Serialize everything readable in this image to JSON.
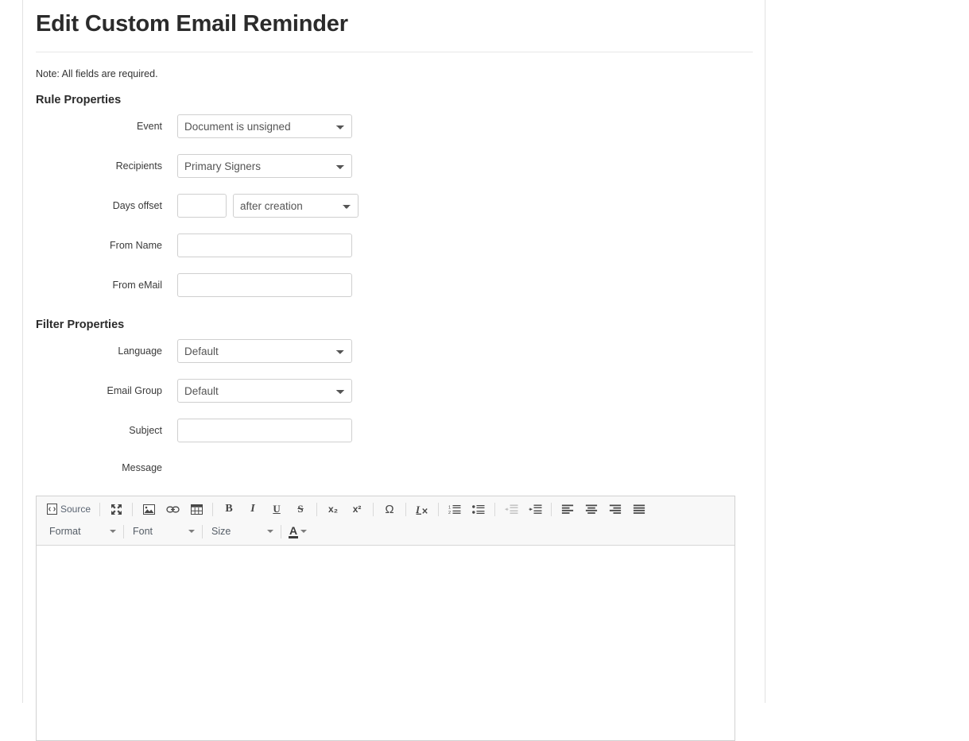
{
  "header": {
    "title": "Edit Custom Email Reminder",
    "note": "Note: All fields are required."
  },
  "sections": {
    "rule_properties": "Rule Properties",
    "filter_properties": "Filter Properties"
  },
  "fields": {
    "event": {
      "label": "Event",
      "value": "Document is unsigned",
      "options": [
        "Document is unsigned"
      ]
    },
    "recipients": {
      "label": "Recipients",
      "value": "Primary Signers",
      "options": [
        "Primary Signers"
      ]
    },
    "days_offset": {
      "label": "Days offset",
      "value": "",
      "placeholder": "",
      "relative_value": "after creation",
      "relative_options": [
        "after creation"
      ]
    },
    "from_name": {
      "label": "From Name",
      "value": "",
      "placeholder": ""
    },
    "from_email": {
      "label": "From eMail",
      "value": "",
      "placeholder": ""
    },
    "language": {
      "label": "Language",
      "value": "Default",
      "options": [
        "Default"
      ]
    },
    "email_group": {
      "label": "Email Group",
      "value": "Default",
      "options": [
        "Default"
      ]
    },
    "subject": {
      "label": "Subject",
      "value": "",
      "placeholder": ""
    },
    "message": {
      "label": "Message",
      "value": ""
    }
  },
  "editor": {
    "toolbar_row1": [
      {
        "name": "source-button",
        "label": "Source",
        "icon": "source-icon"
      },
      {
        "name": "maximize-button",
        "label": "",
        "icon": "maximize-icon"
      },
      {
        "name": "image-button",
        "label": "",
        "icon": "image-icon"
      },
      {
        "name": "link-button",
        "label": "",
        "icon": "link-icon"
      },
      {
        "name": "table-button",
        "label": "",
        "icon": "table-icon"
      },
      {
        "name": "bold-button",
        "label": "B",
        "icon": "bold-icon"
      },
      {
        "name": "italic-button",
        "label": "I",
        "icon": "italic-icon"
      },
      {
        "name": "underline-button",
        "label": "U",
        "icon": "underline-icon"
      },
      {
        "name": "strikethrough-button",
        "label": "S",
        "icon": "strikethrough-icon"
      },
      {
        "name": "subscript-button",
        "label": "x₂",
        "icon": "subscript-icon"
      },
      {
        "name": "superscript-button",
        "label": "x²",
        "icon": "superscript-icon"
      },
      {
        "name": "special-character-button",
        "label": "Ω",
        "icon": "omega-icon"
      },
      {
        "name": "remove-format-button",
        "label": "",
        "icon": "remove-format-icon"
      },
      {
        "name": "numbered-list-button",
        "label": "",
        "icon": "numbered-list-icon"
      },
      {
        "name": "bulleted-list-button",
        "label": "",
        "icon": "bulleted-list-icon"
      },
      {
        "name": "outdent-button",
        "label": "",
        "icon": "outdent-icon"
      },
      {
        "name": "indent-button",
        "label": "",
        "icon": "indent-icon"
      },
      {
        "name": "align-left-button",
        "label": "",
        "icon": "align-left-icon"
      },
      {
        "name": "align-center-button",
        "label": "",
        "icon": "align-center-icon"
      },
      {
        "name": "align-right-button",
        "label": "",
        "icon": "align-right-icon"
      },
      {
        "name": "justify-button",
        "label": "",
        "icon": "align-justify-icon"
      }
    ],
    "toolbar_row2": {
      "format": "Format",
      "font": "Font",
      "size": "Size",
      "text_color": "A"
    },
    "content": ""
  },
  "colors": {
    "title": "#2b2b2b",
    "text": "#333333",
    "border": "#cfcfcf",
    "toolbar_bg": "#f8f8f8",
    "source_label": "#5a6472"
  }
}
